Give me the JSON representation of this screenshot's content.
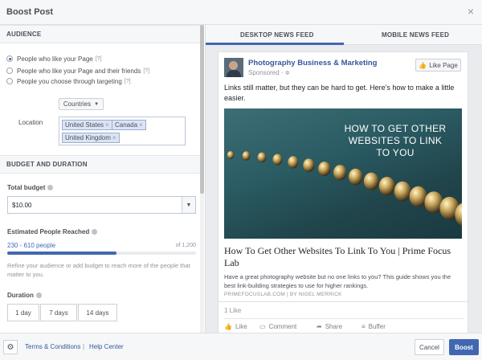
{
  "dialog": {
    "title": "Boost Post",
    "close_glyph": "×"
  },
  "audience": {
    "heading": "AUDIENCE",
    "options": [
      {
        "label": "People who like your Page",
        "help": "[?]",
        "selected": true
      },
      {
        "label": "People who like your Page and their friends",
        "help": "[?]",
        "selected": false
      },
      {
        "label": "People you choose through targeting",
        "help": "[?]",
        "selected": false
      }
    ],
    "countries_label": "Countries",
    "location_label": "Location",
    "locations": [
      "United States",
      "Canada",
      "United Kingdom"
    ],
    "remove_glyph": "×"
  },
  "budget": {
    "heading": "BUDGET AND DURATION",
    "total_label": "Total budget",
    "total_value": "$10.00",
    "reach_label": "Estimated People Reached",
    "reach_value": "230 - 610 people",
    "reach_of": "of 1,200",
    "reach_fraction": 0.58,
    "hint": "Refine your audience or add budget to reach more of the people that matter to you.",
    "duration_label": "Duration",
    "durations": [
      "1 day",
      "7 days",
      "14 days"
    ]
  },
  "tabs": {
    "desktop": "DESKTOP NEWS FEED",
    "mobile": "MOBILE NEWS FEED"
  },
  "post": {
    "page_name": "Photography Business & Marketing",
    "sponsored": "Sponsored",
    "sponsored_sep": "·",
    "like_page": "Like Page",
    "text": "Links still matter, but they can be hard to get. Here's how to make a little easier.",
    "image_text": "HOW TO GET OTHER WEBSITES TO LINK TO YOU",
    "link_title": "How To Get Other Websites To Link To You | Prime Focus Lab",
    "link_desc": "Have a great photography website but no one links to you? This guide shows you the best link-building strategies to use for higher rankings.",
    "link_source": "PRIMEFOCUSLAB.COM | BY NIGEL MERRICK",
    "likes": "1 Like",
    "actions": {
      "like": "Like",
      "comment": "Comment",
      "share": "Share",
      "buffer": "Buffer"
    }
  },
  "footer": {
    "terms": "Terms & Conditions",
    "sep": "|",
    "help": "Help Center",
    "cancel": "Cancel",
    "boost": "Boost"
  },
  "colors": {
    "accent": "#4267b2",
    "link": "#365899"
  }
}
